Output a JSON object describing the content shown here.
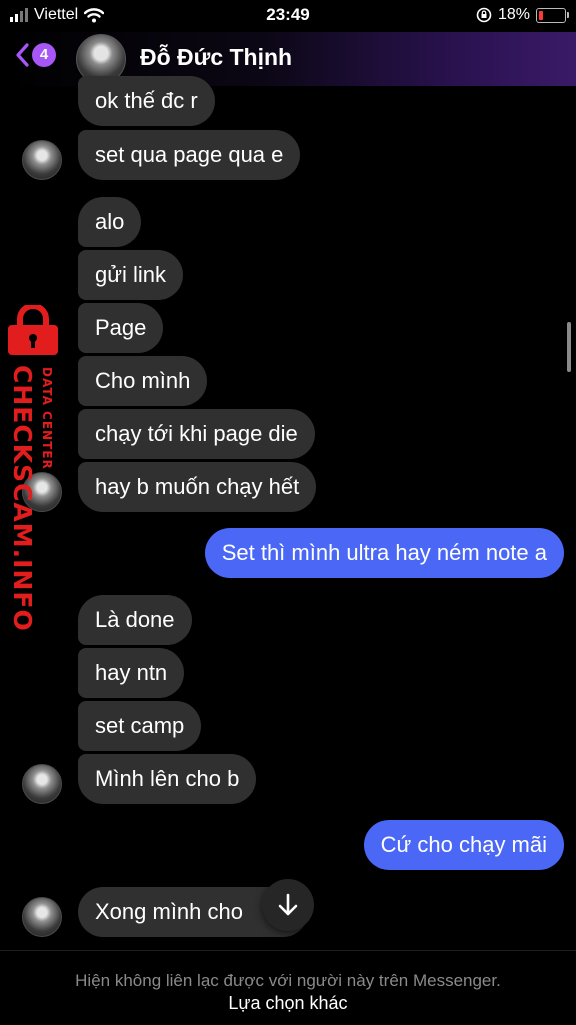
{
  "status_bar": {
    "carrier": "Viettel",
    "time": "23:49",
    "battery": "18%",
    "battery_level": 0.18,
    "battery_color": "#ff3b30"
  },
  "header": {
    "unread_count": "4",
    "contact_name": "Đỗ Đức Thịnh",
    "accent_color": "#a757f5"
  },
  "messages": [
    {
      "side": "in",
      "text": "ok thế đc r"
    },
    {
      "side": "in",
      "text": "set qua page qua e"
    },
    {
      "side": "in",
      "text": "alo"
    },
    {
      "side": "in",
      "text": "gửi link"
    },
    {
      "side": "in",
      "text": "Page"
    },
    {
      "side": "in",
      "text": "Cho mình"
    },
    {
      "side": "in",
      "text": "chạy tới khi page die"
    },
    {
      "side": "in",
      "text": "hay b muốn chạy hết"
    },
    {
      "side": "out",
      "text": "Set thì mình ultra hay ném note a"
    },
    {
      "side": "in",
      "text": "Là done"
    },
    {
      "side": "in",
      "text": "hay ntn"
    },
    {
      "side": "in",
      "text": "set camp"
    },
    {
      "side": "in",
      "text": "Mình lên cho b"
    },
    {
      "side": "out",
      "text": "Cứ cho chạy mãi"
    },
    {
      "side": "in",
      "text": "Xong mình cho     tk"
    }
  ],
  "watermark": {
    "main": "CHECKSCAM.INFO",
    "sub": "DATA CENTER",
    "color": "#e11d1d"
  },
  "footer": {
    "notice": "Hiện không liên lạc được với người này trên Messenger.",
    "other_options": "Lựa chọn khác"
  },
  "icons": [
    "signal-icon",
    "wifi-icon",
    "lock-rotation-icon",
    "battery-icon",
    "back-chevron-icon",
    "avatar",
    "scroll-down-arrow-icon",
    "lock-icon"
  ]
}
